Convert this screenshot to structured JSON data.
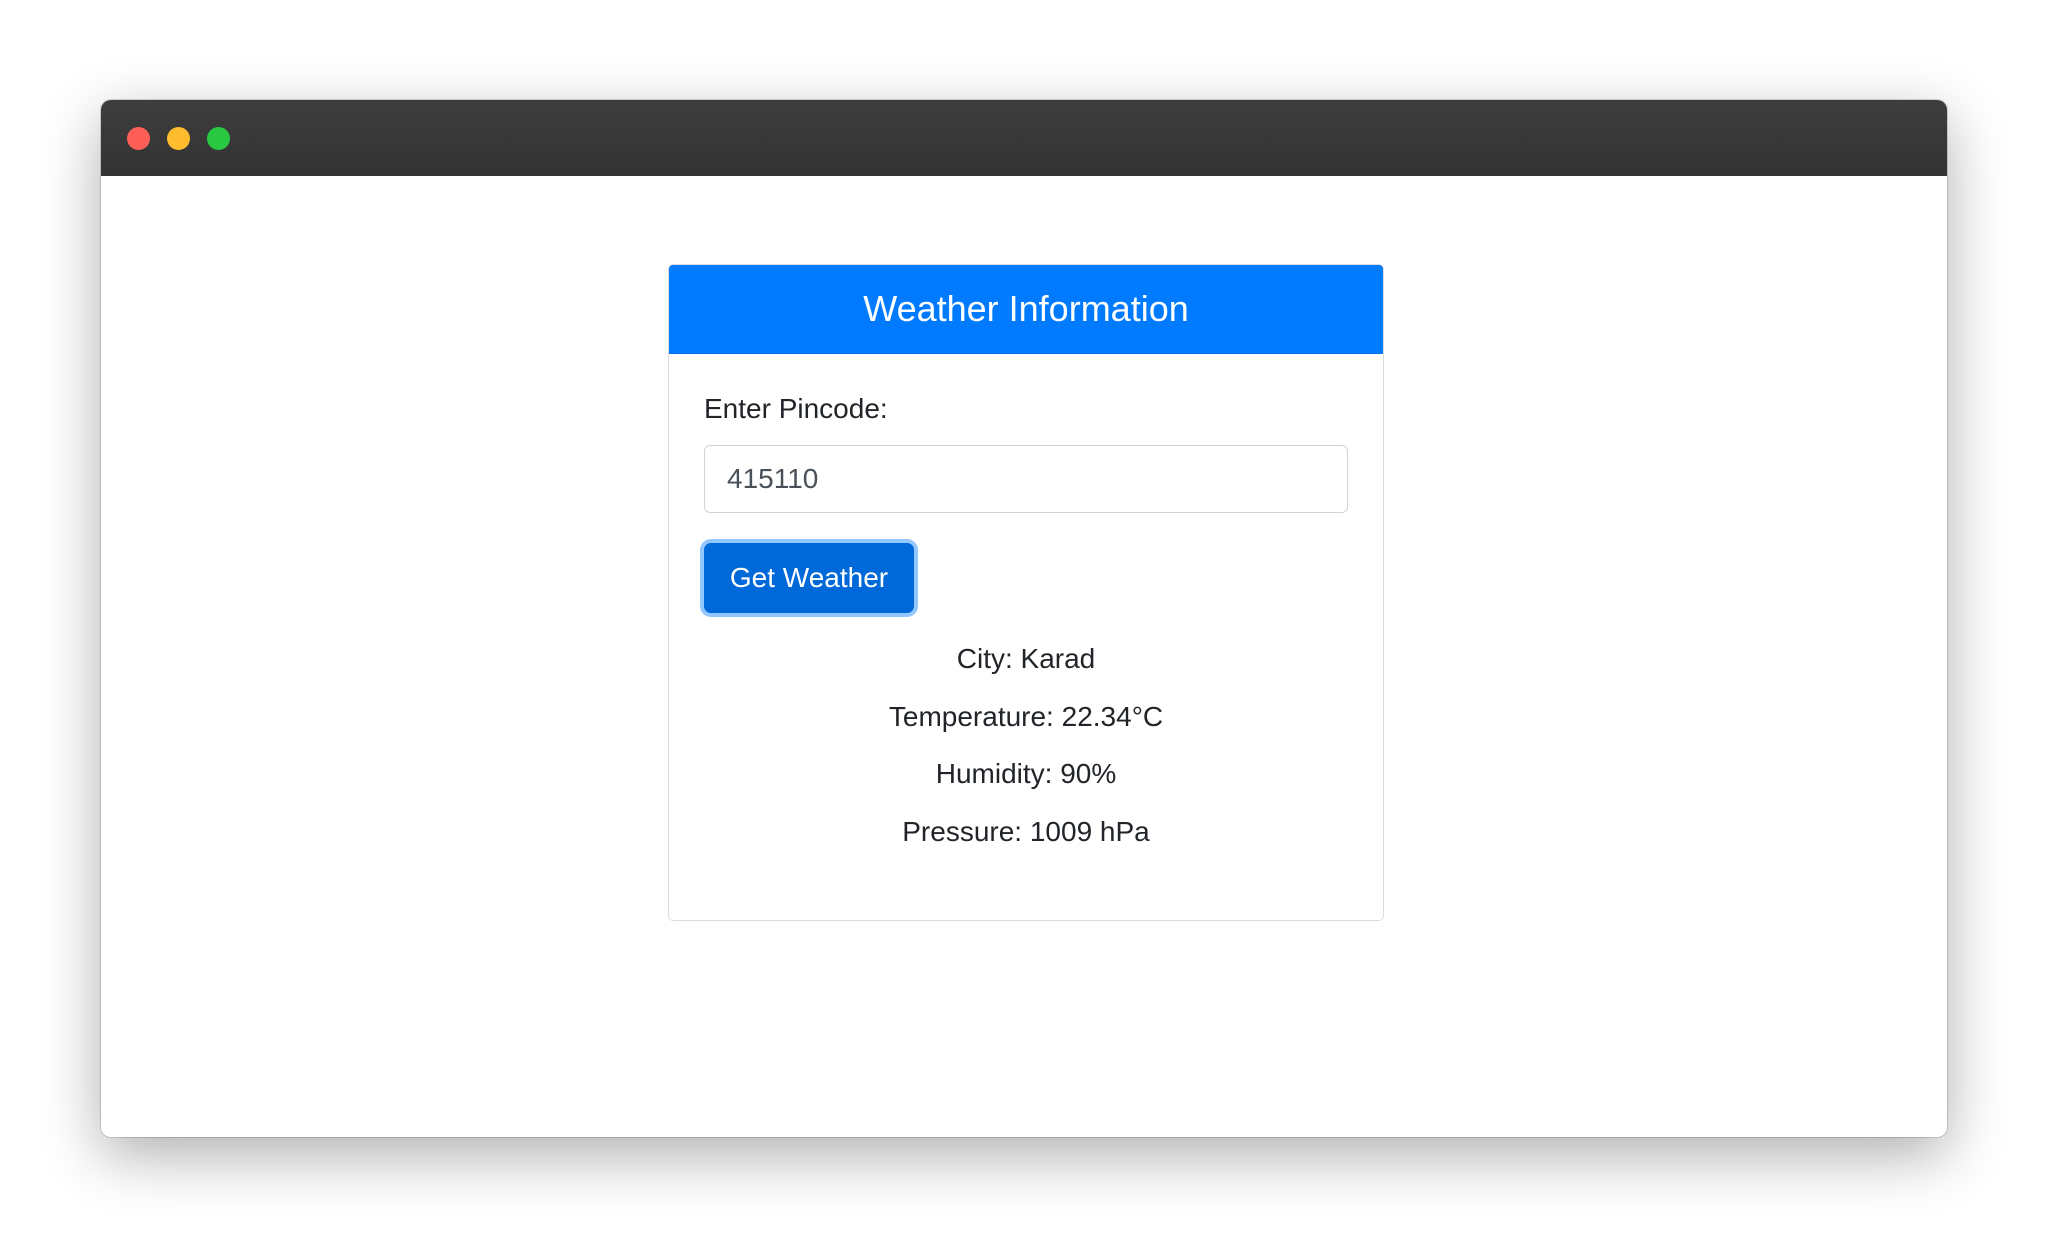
{
  "window": {
    "controls": [
      {
        "name": "close",
        "color": "#ff5f57"
      },
      {
        "name": "minimize",
        "color": "#febc2e"
      },
      {
        "name": "maximize",
        "color": "#28c840"
      }
    ]
  },
  "card": {
    "title": "Weather Information",
    "header_color": "#007bff"
  },
  "form": {
    "pincode_label": "Enter Pincode:",
    "pincode_value": "415110",
    "submit_label": "Get Weather",
    "submit_color": "#0069d9"
  },
  "results": {
    "city": "City: Karad",
    "temperature": "Temperature: 22.34°C",
    "humidity": "Humidity: 90%",
    "pressure": "Pressure: 1009 hPa"
  }
}
